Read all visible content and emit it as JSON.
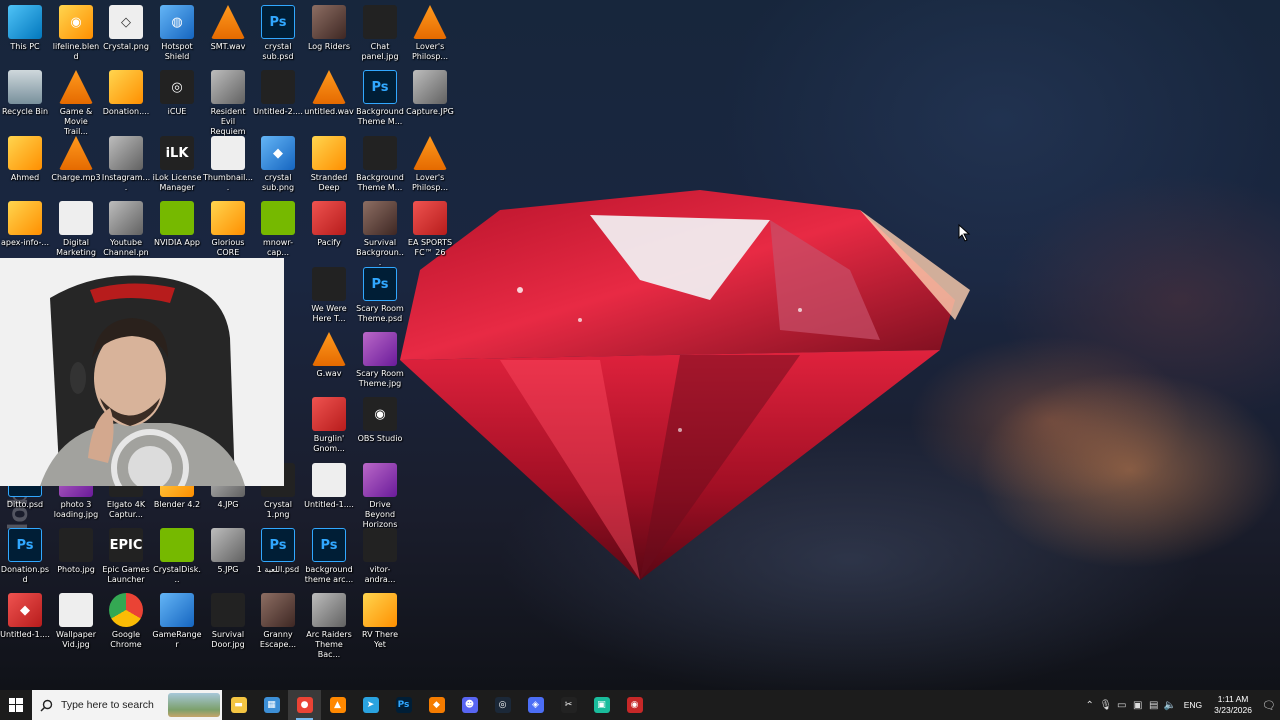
{
  "desktop": {
    "icons": [
      {
        "label": "This PC",
        "icon": "computer-icon",
        "glyph": "",
        "style": "g-pc"
      },
      {
        "label": "lifeline.blend",
        "icon": "blender-icon",
        "glyph": "◉",
        "style": "g-yellow"
      },
      {
        "label": "Crystal.png",
        "icon": "diamond-icon",
        "glyph": "◇",
        "style": "g-white"
      },
      {
        "label": "Hotspot Shield",
        "icon": "hotspot-shield-icon",
        "glyph": "◍",
        "style": "g-blue"
      },
      {
        "label": "SMT.wav",
        "icon": "vlc-icon",
        "glyph": "",
        "style": "g-vlc"
      },
      {
        "label": "crystal sub.psd",
        "icon": "photoshop-file-icon",
        "glyph": "Ps",
        "style": "g-ps"
      },
      {
        "label": "Log Riders",
        "icon": "game-icon",
        "glyph": "",
        "style": "g-img"
      },
      {
        "label": "Chat panel.jpg",
        "icon": "image-file-icon",
        "glyph": "",
        "style": "g-dark"
      },
      {
        "label": "Lover's Philosp...",
        "icon": "vlc-icon",
        "glyph": "",
        "style": "g-vlc"
      },
      {
        "label": "Recycle Bin",
        "icon": "recycle-bin-icon",
        "glyph": "",
        "style": "g-bin"
      },
      {
        "label": "Game & Movie Trail...",
        "icon": "vlc-icon",
        "glyph": "",
        "style": "g-vlc"
      },
      {
        "label": "Donation....",
        "icon": "image-file-icon",
        "glyph": "",
        "style": "g-yellow"
      },
      {
        "label": "iCUE",
        "icon": "icue-icon",
        "glyph": "◎",
        "style": "g-dark"
      },
      {
        "label": "Resident Evil Requiem",
        "icon": "game-icon",
        "glyph": "",
        "style": "g-gray"
      },
      {
        "label": "Untitled-2....",
        "icon": "image-file-icon",
        "glyph": "",
        "style": "g-dark"
      },
      {
        "label": "untitled.wav",
        "icon": "vlc-icon",
        "glyph": "",
        "style": "g-vlc"
      },
      {
        "label": "Background Theme M...",
        "icon": "photoshop-file-icon",
        "glyph": "Ps",
        "style": "g-ps"
      },
      {
        "label": "Capture.JPG",
        "icon": "image-file-icon",
        "glyph": "",
        "style": "g-gray"
      },
      {
        "label": "Ahmed",
        "icon": "user-folder-icon",
        "glyph": "",
        "style": "g-yellow"
      },
      {
        "label": "Charge.mp3",
        "icon": "vlc-icon",
        "glyph": "",
        "style": "g-vlc"
      },
      {
        "label": "Instagram....",
        "icon": "image-file-icon",
        "glyph": "",
        "style": "g-gray"
      },
      {
        "label": "iLok License Manager",
        "icon": "ilok-icon",
        "glyph": "iLK",
        "style": "g-dark"
      },
      {
        "label": "Thumbnail....",
        "icon": "image-file-icon",
        "glyph": "",
        "style": "g-white"
      },
      {
        "label": "crystal sub.png",
        "icon": "diamond-icon",
        "glyph": "◆",
        "style": "g-blue"
      },
      {
        "label": "Stranded Deep",
        "icon": "game-icon",
        "glyph": "",
        "style": "g-yellow"
      },
      {
        "label": "Background Theme M...",
        "icon": "image-file-icon",
        "glyph": "",
        "style": "g-dark"
      },
      {
        "label": "Lover's Philosp...",
        "icon": "vlc-icon",
        "glyph": "",
        "style": "g-vlc"
      },
      {
        "label": "apex-info-...",
        "icon": "image-file-icon",
        "glyph": "",
        "style": "g-yellow"
      },
      {
        "label": "Digital Marketing ...",
        "icon": "document-icon",
        "glyph": "",
        "style": "g-white"
      },
      {
        "label": "Youtube Channel.png",
        "icon": "image-file-icon",
        "glyph": "",
        "style": "g-gray"
      },
      {
        "label": "NVIDIA App",
        "icon": "nvidia-icon",
        "glyph": "",
        "style": "g-green"
      },
      {
        "label": "Glorious CORE",
        "icon": "glorious-icon",
        "glyph": "",
        "style": "g-yellow"
      },
      {
        "label": "mnowr-cap...",
        "icon": "image-file-icon",
        "glyph": "",
        "style": "g-green"
      },
      {
        "label": "Pacify",
        "icon": "game-icon",
        "glyph": "",
        "style": "g-red"
      },
      {
        "label": "Survival Backgroun...",
        "icon": "image-file-icon",
        "glyph": "",
        "style": "g-img"
      },
      {
        "label": "EA SPORTS FC™ 26",
        "icon": "game-icon",
        "glyph": "",
        "style": "g-red"
      },
      {
        "label": "We Were Here T...",
        "icon": "game-icon",
        "glyph": "",
        "style": "g-dark"
      },
      {
        "label": "Scary Room Theme.psd",
        "icon": "photoshop-file-icon",
        "glyph": "Ps",
        "style": "g-ps"
      },
      {
        "label": "G.wav",
        "icon": "vlc-icon",
        "glyph": "",
        "style": "g-vlc"
      },
      {
        "label": "Scary Room Theme.jpg",
        "icon": "image-file-icon",
        "glyph": "",
        "style": "g-purple"
      },
      {
        "label": "Burglin' Gnom...",
        "icon": "game-icon",
        "glyph": "",
        "style": "g-red"
      },
      {
        "label": "OBS Studio",
        "icon": "obs-icon",
        "glyph": "◉",
        "style": "g-dark"
      },
      {
        "label": "Ditto.psd",
        "icon": "photoshop-file-icon",
        "glyph": "Ps",
        "style": "g-ps"
      },
      {
        "label": "photo 3 loading.jpg",
        "icon": "image-file-icon",
        "glyph": "",
        "style": "g-purple"
      },
      {
        "label": "Elgato 4K Captur...",
        "icon": "elgato-icon",
        "glyph": "",
        "style": "g-dark"
      },
      {
        "label": "Blender 4.2",
        "icon": "blender-icon",
        "glyph": "◉",
        "style": "g-yellow"
      },
      {
        "label": "4.JPG",
        "icon": "image-file-icon",
        "glyph": "",
        "style": "g-gray"
      },
      {
        "label": "Crystal 1.png",
        "icon": "diamond-icon",
        "glyph": "",
        "style": "g-dark"
      },
      {
        "label": "Untitled-1....",
        "icon": "image-file-icon",
        "glyph": "",
        "style": "g-white"
      },
      {
        "label": "Drive Beyond Horizons",
        "icon": "game-icon",
        "glyph": "",
        "style": "g-purple"
      },
      {
        "label": "Donation.psd",
        "icon": "photoshop-file-icon",
        "glyph": "Ps",
        "style": "g-ps"
      },
      {
        "label": "Photo.jpg",
        "icon": "image-file-icon",
        "glyph": "",
        "style": "g-dark"
      },
      {
        "label": "Epic Games Launcher",
        "icon": "epic-games-icon",
        "glyph": "EPIC",
        "style": "g-dark"
      },
      {
        "label": "CrystalDisk...",
        "icon": "crystaldisk-icon",
        "glyph": "",
        "style": "g-green"
      },
      {
        "label": "5.JPG",
        "icon": "image-file-icon",
        "glyph": "",
        "style": "g-gray"
      },
      {
        "label": "اللعبة 1.psd",
        "icon": "photoshop-file-icon",
        "glyph": "Ps",
        "style": "g-ps"
      },
      {
        "label": "background theme arc...",
        "icon": "photoshop-file-icon",
        "glyph": "Ps",
        "style": "g-ps"
      },
      {
        "label": "vitor-andra...",
        "icon": "image-file-icon",
        "glyph": "",
        "style": "g-dark"
      },
      {
        "label": "Untitled-1....",
        "icon": "diamond-icon",
        "glyph": "◆",
        "style": "g-red"
      },
      {
        "label": "Wallpaper Vid.jpg",
        "icon": "image-file-icon",
        "glyph": "",
        "style": "g-white"
      },
      {
        "label": "Google Chrome",
        "icon": "chrome-icon",
        "glyph": "",
        "style": "g-chrome"
      },
      {
        "label": "GameRanger",
        "icon": "gameranger-icon",
        "glyph": "",
        "style": "g-blue"
      },
      {
        "label": "Survival Door.jpg",
        "icon": "image-file-icon",
        "glyph": "",
        "style": "g-dark"
      },
      {
        "label": "Granny Escape...",
        "icon": "game-icon",
        "glyph": "",
        "style": "g-img"
      },
      {
        "label": "Arc Raiders Theme Bac...",
        "icon": "image-file-icon",
        "glyph": "",
        "style": "g-gray"
      },
      {
        "label": "RV There Yet",
        "icon": "game-icon",
        "glyph": "",
        "style": "g-yellow"
      }
    ]
  },
  "taskbar": {
    "search_placeholder": "Type here to search",
    "apps": [
      {
        "name": "file-explorer-icon",
        "glyph": "▬",
        "color": "#f4c542"
      },
      {
        "name": "photo-viewer-icon",
        "glyph": "▦",
        "color": "#3d8fd6"
      },
      {
        "name": "chrome-icon",
        "glyph": "●",
        "color": "#ea4335"
      },
      {
        "name": "vlc-icon",
        "glyph": "▲",
        "color": "#ff8800"
      },
      {
        "name": "telegram-icon",
        "glyph": "➤",
        "color": "#2aa3e0"
      },
      {
        "name": "photoshop-icon",
        "glyph": "Ps",
        "color": "#001e36"
      },
      {
        "name": "shield-icon",
        "glyph": "◆",
        "color": "#f57c00"
      },
      {
        "name": "discord-icon",
        "glyph": "☻",
        "color": "#5865f2"
      },
      {
        "name": "steam-icon",
        "glyph": "◎",
        "color": "#1b2838"
      },
      {
        "name": "dev-tool-icon",
        "glyph": "◈",
        "color": "#4c6ef5"
      },
      {
        "name": "capcut-icon",
        "glyph": "✂",
        "color": "#222"
      },
      {
        "name": "app-green-icon",
        "glyph": "▣",
        "color": "#1abc9c"
      },
      {
        "name": "obs-icon",
        "glyph": "◉",
        "color": "#c62828"
      }
    ],
    "active_app": "chrome-icon",
    "tray": {
      "language": "ENG",
      "time": "1:11 AM",
      "date": "3/23/2026"
    }
  },
  "overlay": {
    "watermark": "Adobe Stock"
  }
}
